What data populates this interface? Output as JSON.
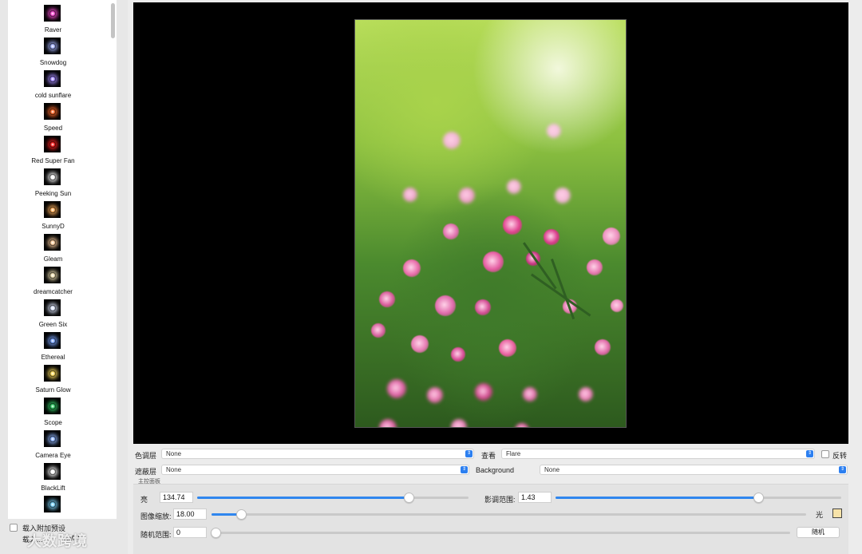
{
  "presets": [
    {
      "label": "Raver",
      "color": "#ff4fd8"
    },
    {
      "label": "Snowdog",
      "color": "#a6b4ff"
    },
    {
      "label": "cold sunflare",
      "color": "#a58bff"
    },
    {
      "label": "Speed",
      "color": "#ff6a2b"
    },
    {
      "label": "Red Super Fan",
      "color": "#ff2020"
    },
    {
      "label": "Peeking Sun",
      "color": "#ffffff"
    },
    {
      "label": "SunnyD",
      "color": "#ffb05c"
    },
    {
      "label": "Gleam",
      "color": "#ffd0a0"
    },
    {
      "label": "dreamcatcher",
      "color": "#f2e3b5"
    },
    {
      "label": "Green Six",
      "color": "#dfe8ff"
    },
    {
      "label": "Ethereal",
      "color": "#7aa5ff"
    },
    {
      "label": "Saturn Glow",
      "color": "#ffe060"
    },
    {
      "label": "Scope",
      "color": "#35d06a"
    },
    {
      "label": "Camera Eye",
      "color": "#8fb6ff"
    },
    {
      "label": "BlackLift",
      "color": "#ffffff"
    },
    {
      "label": "",
      "color": "#7fd8ff"
    }
  ],
  "left_bottom": {
    "append_label": "载入附加预设",
    "load_label": "载入...",
    "other_label": "XMH"
  },
  "watermark": "大数跨境",
  "controls": {
    "color_layer_label": "色调层",
    "color_layer_value": "None",
    "view_label": "查看",
    "view_value": "Flare",
    "invert_label": "反转",
    "mask_layer_label": "遮蔽层",
    "mask_layer_value": "None",
    "background_label": "Background",
    "background_value": "None",
    "panel_title": "主控面板",
    "brightness_label": "亮",
    "brightness_value": "134.74",
    "brightness_fraction": 0.78,
    "shadow_label": "影调范围:",
    "shadow_value": "1.43",
    "shadow_fraction": 0.71,
    "scale_label": "图像缩放:",
    "scale_value": "18.00",
    "scale_fraction": 0.05,
    "light_label": "光",
    "light_color": "#f7e3a9",
    "random_label": "随机范围:",
    "random_value": "0",
    "random_fraction": 0.0,
    "random_button": "随机"
  }
}
